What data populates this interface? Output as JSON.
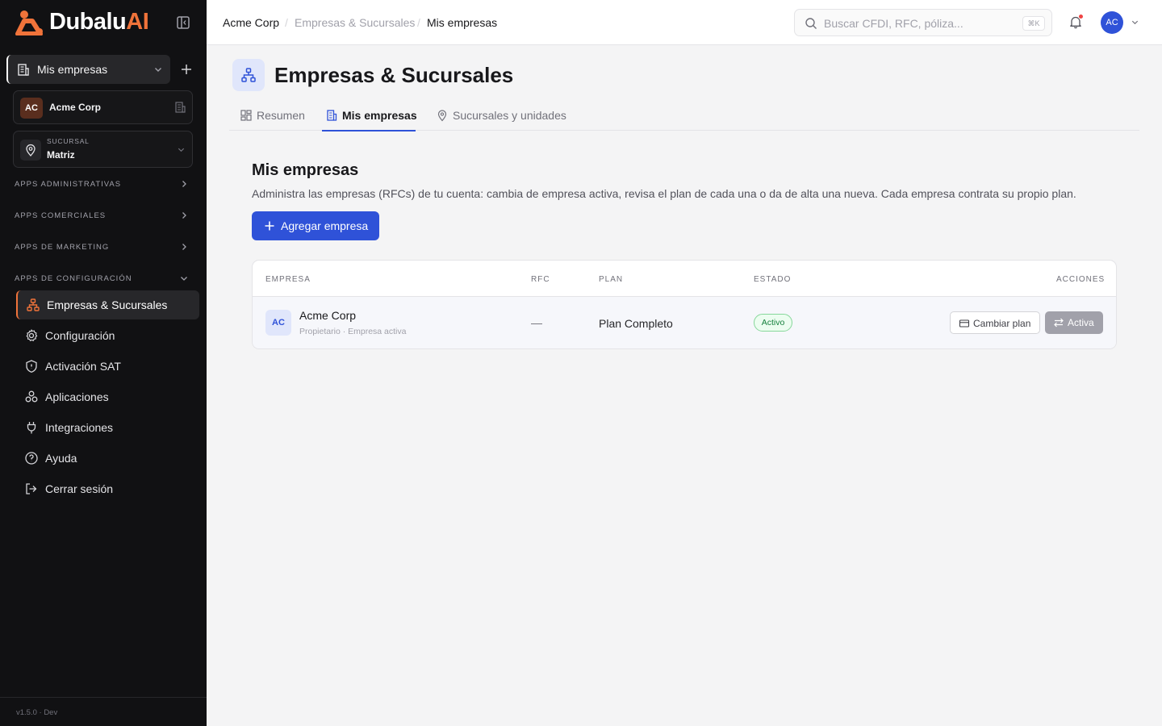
{
  "brand": {
    "name": "Dubalu",
    "suffix": "AI",
    "accent": "#f0733a",
    "primary": "#2f52d8"
  },
  "sidebar": {
    "company_switcher": {
      "label": "Mis empresas"
    },
    "current_company": {
      "initials": "AC",
      "name": "Acme Corp"
    },
    "branch": {
      "caption": "SUCURSAL",
      "value": "Matriz"
    },
    "sections": [
      {
        "label": "APPS ADMINISTRATIVAS"
      },
      {
        "label": "APPS COMERCIALES"
      },
      {
        "label": "APPS DE MARKETING"
      },
      {
        "label": "APPS DE CONFIGURACIÓN"
      }
    ],
    "items": [
      {
        "label": "Empresas & Sucursales",
        "icon": "org-chart-icon"
      },
      {
        "label": "Configuración",
        "icon": "gear-icon"
      },
      {
        "label": "Activación SAT",
        "icon": "shield-icon"
      },
      {
        "label": "Aplicaciones",
        "icon": "apps-icon"
      },
      {
        "label": "Integraciones",
        "icon": "plug-icon"
      },
      {
        "label": "Ayuda",
        "icon": "help-icon"
      },
      {
        "label": "Cerrar sesión",
        "icon": "logout-icon"
      }
    ],
    "version": "v1.5.0 · Dev"
  },
  "header": {
    "breadcrumb": [
      "Acme Corp",
      "Empresas & Sucursales",
      "Mis empresas"
    ],
    "search": {
      "placeholder": "Buscar CFDI, RFC, póliza...",
      "shortcut": "⌘K"
    },
    "user_initials": "AC"
  },
  "page": {
    "title": "Empresas & Sucursales",
    "tabs": [
      {
        "label": "Resumen"
      },
      {
        "label": "Mis empresas"
      },
      {
        "label": "Sucursales y unidades"
      }
    ],
    "section_title": "Mis empresas",
    "section_desc": "Administra las empresas (RFCs) de tu cuenta: cambia de empresa activa, revisa el plan de cada una o da de alta una nueva. Cada empresa contrata su propio plan.",
    "add_button": "Agregar empresa"
  },
  "table": {
    "headers": [
      "EMPRESA",
      "RFC",
      "PLAN",
      "ESTADO",
      "ACCIONES"
    ],
    "rows": [
      {
        "initials": "AC",
        "name": "Acme Corp",
        "subtitle": "Propietario · Empresa activa",
        "rfc": "—",
        "plan": "Plan Completo",
        "status": "Activo",
        "change_plan": "Cambiar plan",
        "active_action": "Activa"
      }
    ]
  }
}
